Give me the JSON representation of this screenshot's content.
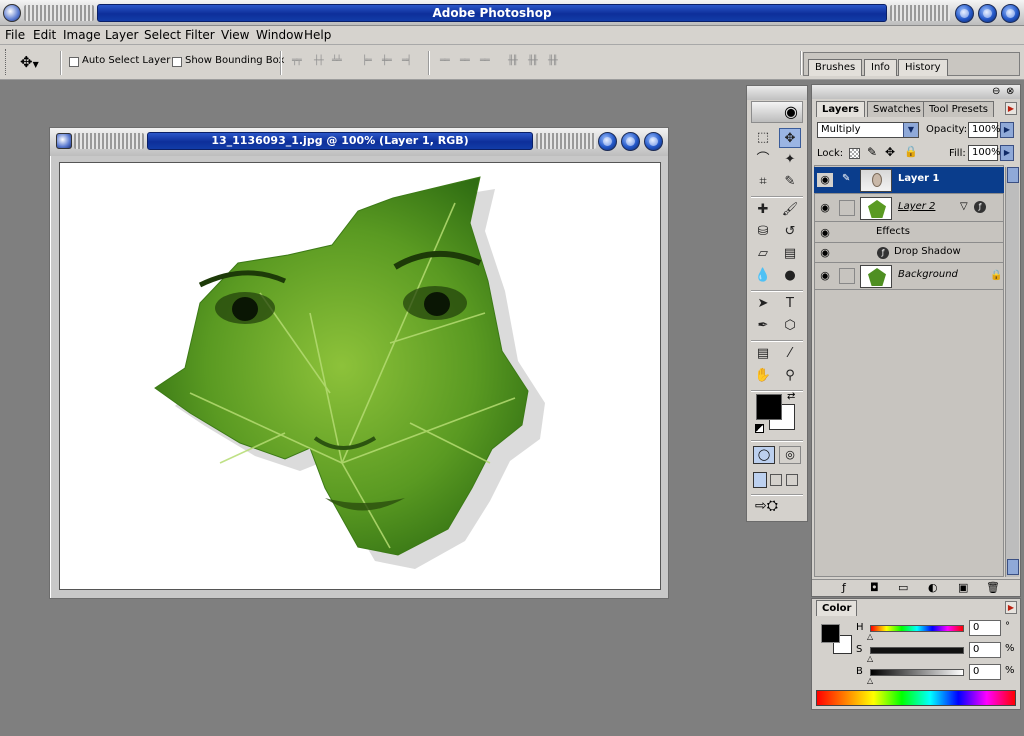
{
  "app": {
    "title": "Adobe Photoshop"
  },
  "menu": [
    "File",
    "Edit",
    "Image",
    "Layer",
    "Select",
    "Filter",
    "View",
    "Window",
    "Help"
  ],
  "options": {
    "auto_select": "Auto Select Layer",
    "bounding_box": "Show Bounding Box"
  },
  "palette_well": {
    "tabs": [
      "Brushes",
      "Info",
      "History"
    ]
  },
  "document": {
    "title": "13_1136093_1.jpg @ 100% (Layer 1, RGB)"
  },
  "layers_panel": {
    "tabs": [
      "Layers",
      "Swatches",
      "Tool Presets"
    ],
    "blend_mode": "Multiply",
    "opacity_label": "Opacity:",
    "opacity_value": "100%",
    "lock_label": "Lock:",
    "fill_label": "Fill:",
    "fill_value": "100%",
    "layers": [
      {
        "name": "Layer 1",
        "selected": true
      },
      {
        "name": "Layer 2",
        "selected": false
      },
      {
        "name": "Effects",
        "selected": false
      },
      {
        "name": "Drop Shadow",
        "selected": false
      },
      {
        "name": "Background",
        "selected": false
      }
    ]
  },
  "color_panel": {
    "tab": "Color",
    "channels": [
      {
        "label": "H",
        "value": "0",
        "unit": "°"
      },
      {
        "label": "S",
        "value": "0",
        "unit": "%"
      },
      {
        "label": "B",
        "value": "0",
        "unit": "%"
      }
    ],
    "foreground": "#000000",
    "background": "#ffffff"
  },
  "colors": {
    "title_blue": "#0d2f9a",
    "leaf_green": "#4f8f22",
    "selection_blue": "#0a3d8c"
  }
}
